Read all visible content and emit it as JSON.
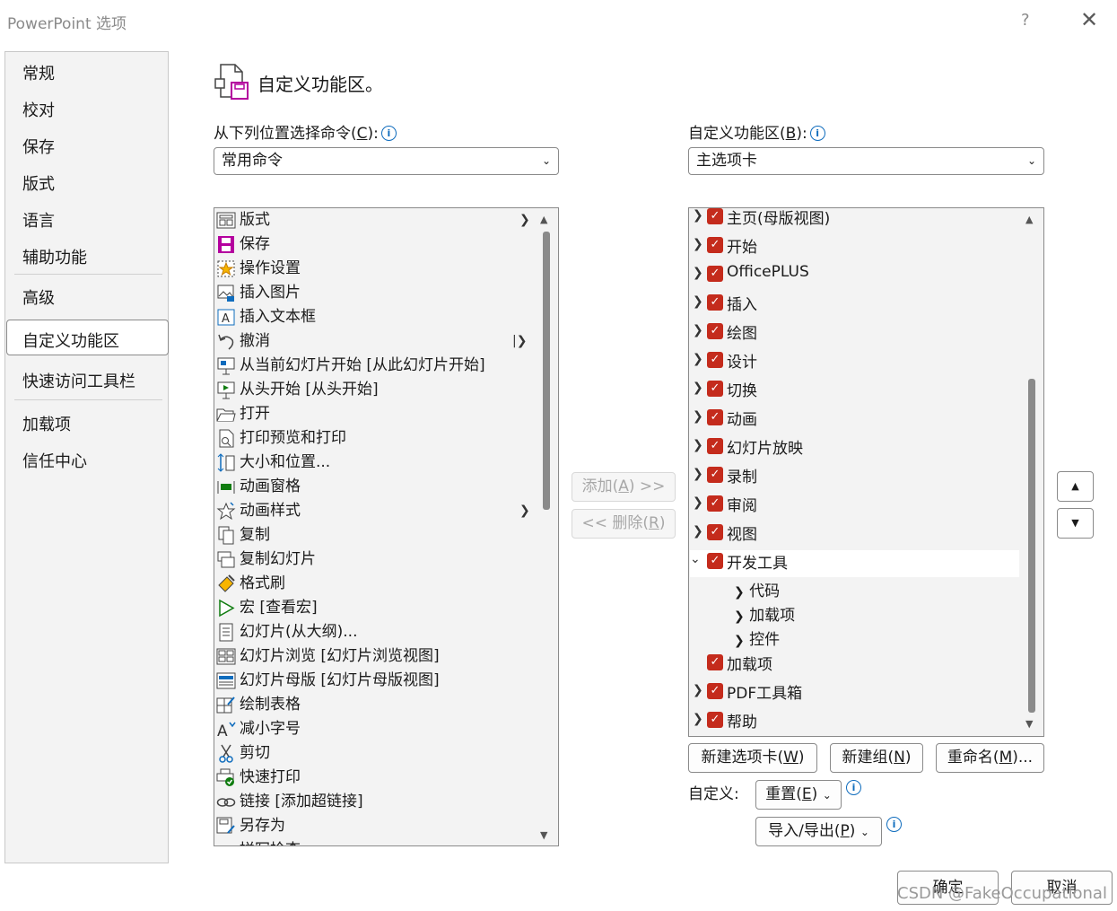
{
  "window": {
    "title": "PowerPoint 选项",
    "help": "?",
    "close": "✕"
  },
  "nav": {
    "items": [
      "常规",
      "校对",
      "保存",
      "版式",
      "语言",
      "辅助功能",
      "高级",
      "自定义功能区",
      "快速访问工具栏",
      "加载项",
      "信任中心"
    ],
    "selected": "自定义功能区"
  },
  "header": {
    "title": "自定义功能区。"
  },
  "left": {
    "label_prefix": "从下列位置选择命令(",
    "label_key": "C",
    "label_suffix": "):",
    "combo_value": "常用命令",
    "commands": [
      "版式",
      "保存",
      "操作设置",
      "插入图片",
      "插入文本框",
      "撤消",
      "从当前幻灯片开始 [从此幻灯片开始]",
      "从头开始 [从头开始]",
      "打开",
      "打印预览和打印",
      "大小和位置...",
      "动画窗格",
      "动画样式",
      "复制",
      "复制幻灯片",
      "格式刷",
      "宏 [查看宏]",
      "幻灯片(从大纲)...",
      "幻灯片浏览 [幻灯片浏览视图]",
      "幻灯片母版 [幻灯片母版视图]",
      "绘制表格",
      "减小字号",
      "剪切",
      "快速打印",
      "链接 [添加超链接]",
      "另存为",
      "拼写检查"
    ]
  },
  "middle": {
    "add_text": "添加(",
    "add_key": "A",
    "add_suffix": ") >>",
    "remove_prefix": "<< 删除(",
    "remove_key": "R",
    "remove_suffix": ")"
  },
  "right": {
    "label_prefix": "自定义功能区(",
    "label_key": "B",
    "label_suffix": "):",
    "combo_value": "主选项卡",
    "tabs": [
      "主页(母版视图)",
      "开始",
      "OfficePLUS",
      "插入",
      "绘图",
      "设计",
      "切换",
      "动画",
      "幻灯片放映",
      "录制",
      "审阅",
      "视图",
      "开发工具"
    ],
    "dev_children": [
      "代码",
      "加载项",
      "控件"
    ],
    "tabs_after": [
      "加载项",
      "PDF工具箱",
      "帮助"
    ],
    "check": "✓",
    "btn_new_tab": "新建选项卡(",
    "btn_new_tab_key": "W",
    "btn_new_group": "新建组(",
    "btn_new_group_key": "N",
    "btn_rename": "重命名(",
    "btn_rename_key": "M",
    "btn_rename_suffix": ")...",
    "customize_label": "自定义:",
    "btn_reset": "重置(",
    "btn_reset_key": "E",
    "btn_import": "导入/导出(",
    "btn_import_key": "P"
  },
  "footer": {
    "ok": "确定",
    "cancel": "取消",
    "watermark": "CSDN @FakeOccupational"
  },
  "colors": {
    "checkbox": "#c42b1c",
    "info": "#0f6cbd"
  }
}
